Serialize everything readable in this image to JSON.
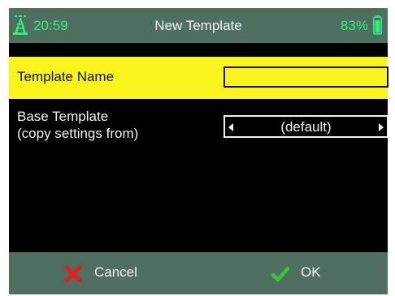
{
  "status_bar": {
    "time": "20:59",
    "title": "New Template",
    "battery_percent": "83%",
    "antenna_icon": "antenna-icon",
    "battery_icon": "battery-icon"
  },
  "form": {
    "template_name": {
      "label": "Template Name",
      "value": ""
    },
    "base_template": {
      "label_line1": "Base Template",
      "label_line2": "(copy settings from)",
      "selected": "(default)"
    }
  },
  "footer": {
    "cancel_label": "Cancel",
    "ok_label": "OK"
  },
  "colors": {
    "statusbar_bg": "#4f6f61",
    "highlight_row": "#fbf31c",
    "accent_green": "#2cf07a",
    "cancel_red": "#e0201e",
    "ok_green": "#3cc43a",
    "screen_bg": "#000000"
  }
}
